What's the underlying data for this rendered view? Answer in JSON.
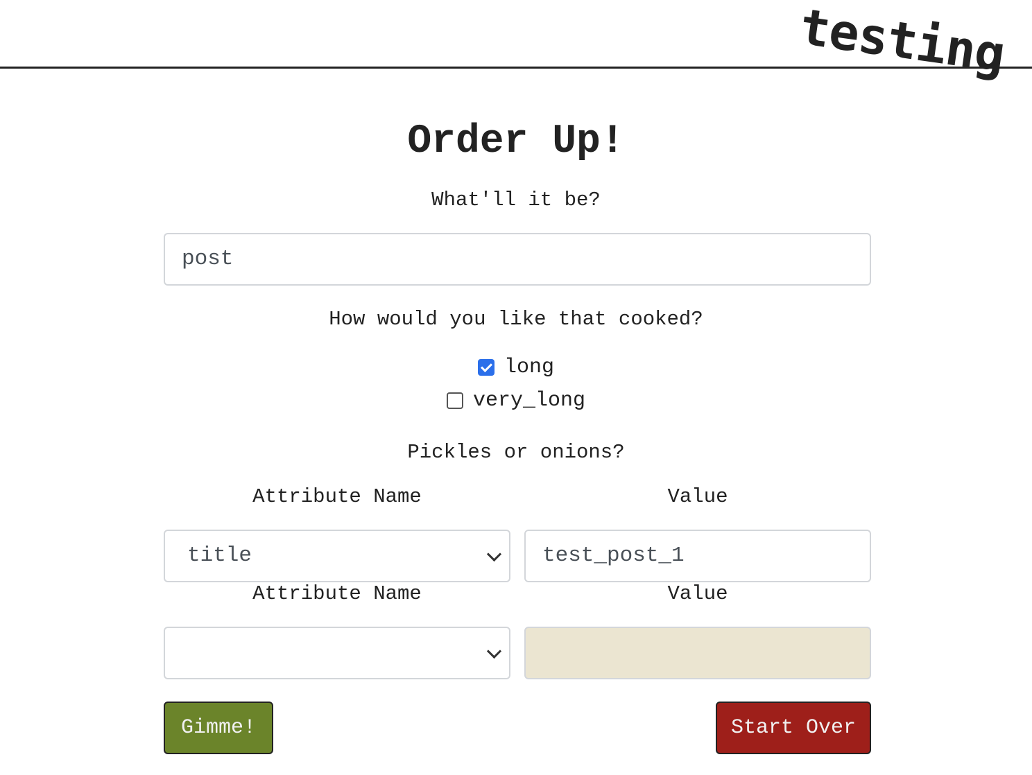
{
  "header": {
    "brand": "testing"
  },
  "form": {
    "title": "Order Up!",
    "question_name": "What'll it be?",
    "name_input_value": "post",
    "question_cook": "How would you like that cooked?",
    "options": [
      {
        "label": "long",
        "checked": true
      },
      {
        "label": "very_long",
        "checked": false
      }
    ],
    "question_attrs": "Pickles or onions?",
    "attribute_rows": [
      {
        "name_header": "Attribute Name",
        "value_header": "Value",
        "selected_name": "title",
        "value": "test_post_1"
      },
      {
        "name_header": "Attribute Name",
        "value_header": "Value",
        "selected_name": "",
        "value": ""
      }
    ],
    "submit_label": "Gimme!",
    "reset_label": "Start Over"
  },
  "colors": {
    "submit_bg": "#6b842a",
    "reset_bg": "#9e1f1a",
    "checkbox_accent": "#2b6fea",
    "disabled_input_bg": "#ebe5d1"
  }
}
